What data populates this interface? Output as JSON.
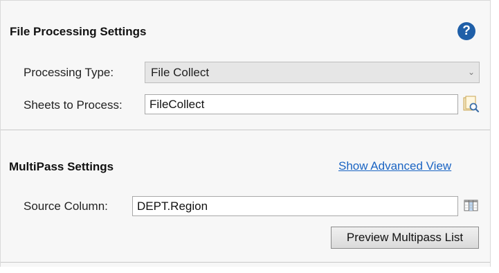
{
  "file_processing": {
    "title": "File Processing Settings",
    "help_icon": "question-circle-icon",
    "processing_type_label": "Processing Type:",
    "processing_type_value": "File Collect",
    "sheets_label": "Sheets to Process:",
    "sheets_value": "FileCollect",
    "sheets_browse_icon": "browse-sheets-icon"
  },
  "multipass": {
    "title": "MultiPass Settings",
    "advanced_link": "Show Advanced View",
    "source_column_label": "Source Column:",
    "source_column_value": "DEPT.Region",
    "column_picker_icon": "column-picker-icon",
    "preview_button": "Preview Multipass List"
  },
  "colors": {
    "accent": "#1f5fa8",
    "link": "#1a64c3",
    "panel_bg": "#f7f7f7"
  }
}
